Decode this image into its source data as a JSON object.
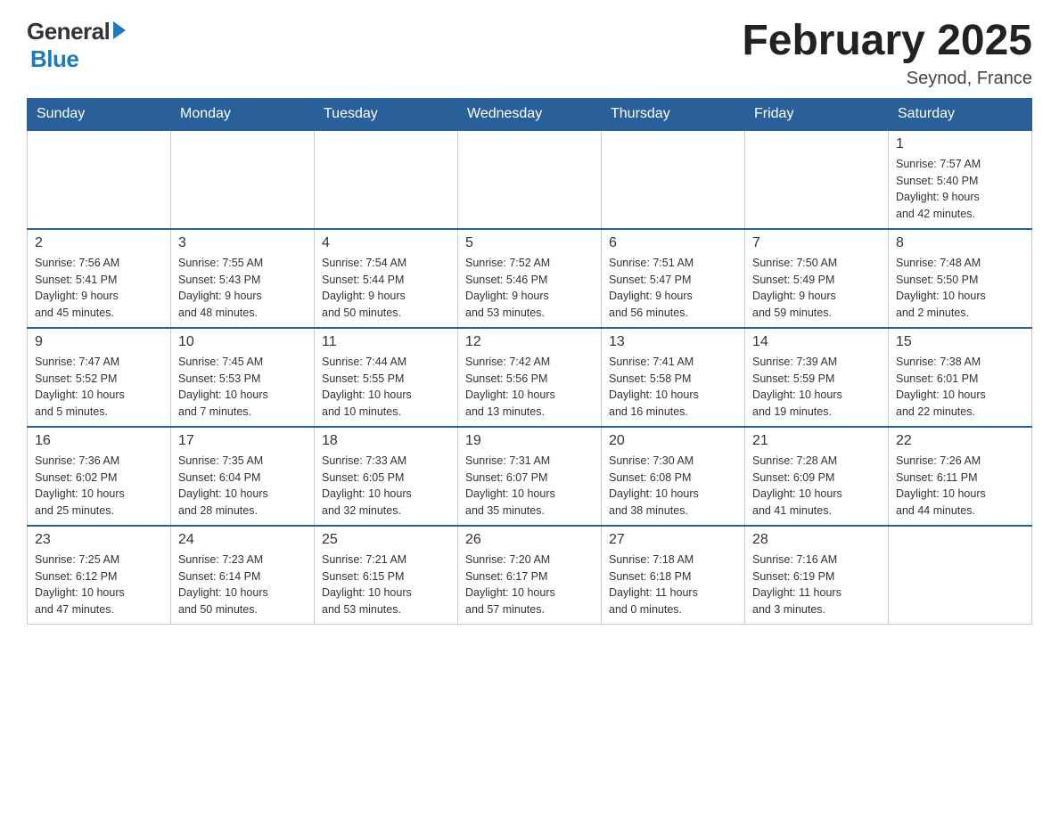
{
  "header": {
    "logo_general": "General",
    "logo_blue": "Blue",
    "month_title": "February 2025",
    "location": "Seynod, France"
  },
  "days_of_week": [
    "Sunday",
    "Monday",
    "Tuesday",
    "Wednesday",
    "Thursday",
    "Friday",
    "Saturday"
  ],
  "weeks": [
    {
      "days": [
        {
          "number": "",
          "info": ""
        },
        {
          "number": "",
          "info": ""
        },
        {
          "number": "",
          "info": ""
        },
        {
          "number": "",
          "info": ""
        },
        {
          "number": "",
          "info": ""
        },
        {
          "number": "",
          "info": ""
        },
        {
          "number": "1",
          "info": "Sunrise: 7:57 AM\nSunset: 5:40 PM\nDaylight: 9 hours\nand 42 minutes."
        }
      ]
    },
    {
      "days": [
        {
          "number": "2",
          "info": "Sunrise: 7:56 AM\nSunset: 5:41 PM\nDaylight: 9 hours\nand 45 minutes."
        },
        {
          "number": "3",
          "info": "Sunrise: 7:55 AM\nSunset: 5:43 PM\nDaylight: 9 hours\nand 48 minutes."
        },
        {
          "number": "4",
          "info": "Sunrise: 7:54 AM\nSunset: 5:44 PM\nDaylight: 9 hours\nand 50 minutes."
        },
        {
          "number": "5",
          "info": "Sunrise: 7:52 AM\nSunset: 5:46 PM\nDaylight: 9 hours\nand 53 minutes."
        },
        {
          "number": "6",
          "info": "Sunrise: 7:51 AM\nSunset: 5:47 PM\nDaylight: 9 hours\nand 56 minutes."
        },
        {
          "number": "7",
          "info": "Sunrise: 7:50 AM\nSunset: 5:49 PM\nDaylight: 9 hours\nand 59 minutes."
        },
        {
          "number": "8",
          "info": "Sunrise: 7:48 AM\nSunset: 5:50 PM\nDaylight: 10 hours\nand 2 minutes."
        }
      ]
    },
    {
      "days": [
        {
          "number": "9",
          "info": "Sunrise: 7:47 AM\nSunset: 5:52 PM\nDaylight: 10 hours\nand 5 minutes."
        },
        {
          "number": "10",
          "info": "Sunrise: 7:45 AM\nSunset: 5:53 PM\nDaylight: 10 hours\nand 7 minutes."
        },
        {
          "number": "11",
          "info": "Sunrise: 7:44 AM\nSunset: 5:55 PM\nDaylight: 10 hours\nand 10 minutes."
        },
        {
          "number": "12",
          "info": "Sunrise: 7:42 AM\nSunset: 5:56 PM\nDaylight: 10 hours\nand 13 minutes."
        },
        {
          "number": "13",
          "info": "Sunrise: 7:41 AM\nSunset: 5:58 PM\nDaylight: 10 hours\nand 16 minutes."
        },
        {
          "number": "14",
          "info": "Sunrise: 7:39 AM\nSunset: 5:59 PM\nDaylight: 10 hours\nand 19 minutes."
        },
        {
          "number": "15",
          "info": "Sunrise: 7:38 AM\nSunset: 6:01 PM\nDaylight: 10 hours\nand 22 minutes."
        }
      ]
    },
    {
      "days": [
        {
          "number": "16",
          "info": "Sunrise: 7:36 AM\nSunset: 6:02 PM\nDaylight: 10 hours\nand 25 minutes."
        },
        {
          "number": "17",
          "info": "Sunrise: 7:35 AM\nSunset: 6:04 PM\nDaylight: 10 hours\nand 28 minutes."
        },
        {
          "number": "18",
          "info": "Sunrise: 7:33 AM\nSunset: 6:05 PM\nDaylight: 10 hours\nand 32 minutes."
        },
        {
          "number": "19",
          "info": "Sunrise: 7:31 AM\nSunset: 6:07 PM\nDaylight: 10 hours\nand 35 minutes."
        },
        {
          "number": "20",
          "info": "Sunrise: 7:30 AM\nSunset: 6:08 PM\nDaylight: 10 hours\nand 38 minutes."
        },
        {
          "number": "21",
          "info": "Sunrise: 7:28 AM\nSunset: 6:09 PM\nDaylight: 10 hours\nand 41 minutes."
        },
        {
          "number": "22",
          "info": "Sunrise: 7:26 AM\nSunset: 6:11 PM\nDaylight: 10 hours\nand 44 minutes."
        }
      ]
    },
    {
      "days": [
        {
          "number": "23",
          "info": "Sunrise: 7:25 AM\nSunset: 6:12 PM\nDaylight: 10 hours\nand 47 minutes."
        },
        {
          "number": "24",
          "info": "Sunrise: 7:23 AM\nSunset: 6:14 PM\nDaylight: 10 hours\nand 50 minutes."
        },
        {
          "number": "25",
          "info": "Sunrise: 7:21 AM\nSunset: 6:15 PM\nDaylight: 10 hours\nand 53 minutes."
        },
        {
          "number": "26",
          "info": "Sunrise: 7:20 AM\nSunset: 6:17 PM\nDaylight: 10 hours\nand 57 minutes."
        },
        {
          "number": "27",
          "info": "Sunrise: 7:18 AM\nSunset: 6:18 PM\nDaylight: 11 hours\nand 0 minutes."
        },
        {
          "number": "28",
          "info": "Sunrise: 7:16 AM\nSunset: 6:19 PM\nDaylight: 11 hours\nand 3 minutes."
        },
        {
          "number": "",
          "info": ""
        }
      ]
    }
  ]
}
